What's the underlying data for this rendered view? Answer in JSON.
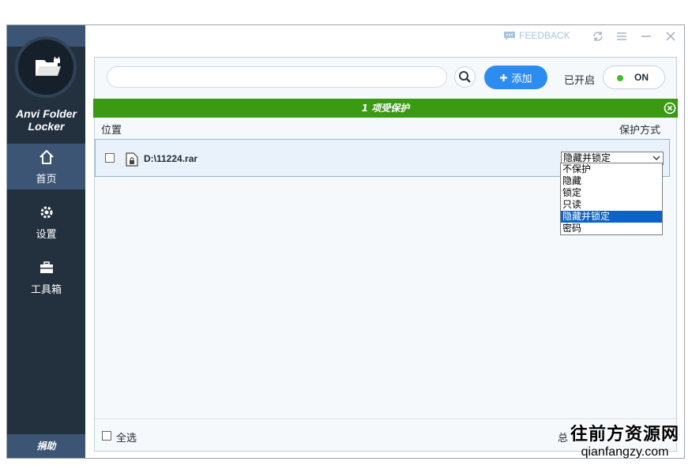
{
  "app": {
    "name_line1": "Anvi Folder",
    "name_line2": "Locker"
  },
  "sidebar": {
    "items": [
      {
        "label": "首页",
        "icon": "home-icon",
        "active": true
      },
      {
        "label": "设置",
        "icon": "gear-icon",
        "active": false
      },
      {
        "label": "工具箱",
        "icon": "toolbox-icon",
        "active": false
      }
    ],
    "donate_label": "捐助"
  },
  "titlebar": {
    "feedback_label": "FEEDBACK"
  },
  "toolbar": {
    "search_placeholder": "",
    "add_label": "添加",
    "enabled_label": "已开启",
    "toggle_label": "ON"
  },
  "status": {
    "text": "1 项受保护",
    "color": "#3a9a14"
  },
  "table": {
    "col_location": "位置",
    "col_protection": "保护方式",
    "rows": [
      {
        "path": "D:\\11224.rar",
        "protection": "隐藏并锁定"
      }
    ]
  },
  "dropdown": {
    "options": [
      "不保护",
      "隐藏",
      "锁定",
      "只读",
      "隐藏并锁定",
      "密码"
    ],
    "selected": "隐藏并锁定"
  },
  "footer": {
    "select_all_label": "全选",
    "total_label": "总"
  },
  "watermark": {
    "line1": "往前方资源网",
    "line2": "qianfangzy.com"
  },
  "colors": {
    "accent": "#2d8cf0",
    "sidebar": "#23313f",
    "sidebar_active": "#3d5574",
    "status_green": "#3a9a14"
  }
}
